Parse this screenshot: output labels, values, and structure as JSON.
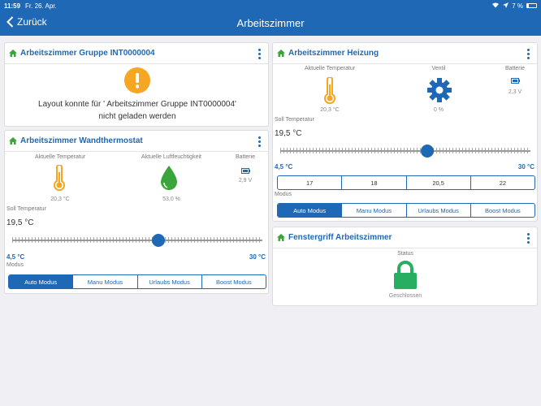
{
  "status": {
    "time": "11:59",
    "date": "Fr. 26. Apr.",
    "battery": "7 %"
  },
  "nav": {
    "back_label": "Zurück",
    "title": "Arbeitszimmer"
  },
  "group_card": {
    "title": "Arbeitszimmer Gruppe INT0000004",
    "message": "Layout konnte für ' Arbeitszimmer Gruppe INT0000004' nicht geladen werden"
  },
  "wall_card": {
    "title": "Arbeitszimmer Wandthermostat",
    "temp_label": "Aktuelle Temperatur",
    "temp_value": "20,3 °C",
    "humidity_label": "Aktuelle Luftfeuchtigkeit",
    "humidity_value": "53,0 %",
    "battery_label": "Batterie",
    "battery_value": "2,9 V",
    "set_label": "Soll Temperatur",
    "set_value": "19,5 °C",
    "min_label": "4,5 °C",
    "max_label": "30 °C",
    "slider_fraction": 0.588,
    "mode_label": "Modus",
    "modes": [
      "Auto Modus",
      "Manu Modus",
      "Urlaubs Modus",
      "Boost Modus"
    ],
    "active_mode": "Auto Modus"
  },
  "heat_card": {
    "title": "Arbeitszimmer Heizung",
    "temp_label": "Aktuelle Temperatur",
    "temp_value": "20,3 °C",
    "valve_label": "Ventil",
    "valve_value": "0 %",
    "battery_label": "Batterie",
    "battery_value": "2,3 V",
    "set_label": "Soll Temperatur",
    "set_value": "19,5 °C",
    "min_label": "4,5 °C",
    "max_label": "30 °C",
    "slider_fraction": 0.588,
    "presets": [
      "17",
      "18",
      "20,5",
      "22"
    ],
    "mode_label": "Modus",
    "modes": [
      "Auto Modus",
      "Manu Modus",
      "Urlaubs Modus",
      "Boost Modus"
    ],
    "active_mode": "Auto Modus"
  },
  "window_card": {
    "title": "Fenstergriff Arbeitszimmer",
    "status_label": "Status",
    "status_value": "Geschlossen"
  },
  "colors": {
    "accent": "#1f68b5",
    "warning": "#f5a623",
    "humidity": "#3aa53a",
    "lock": "#27ae60"
  }
}
